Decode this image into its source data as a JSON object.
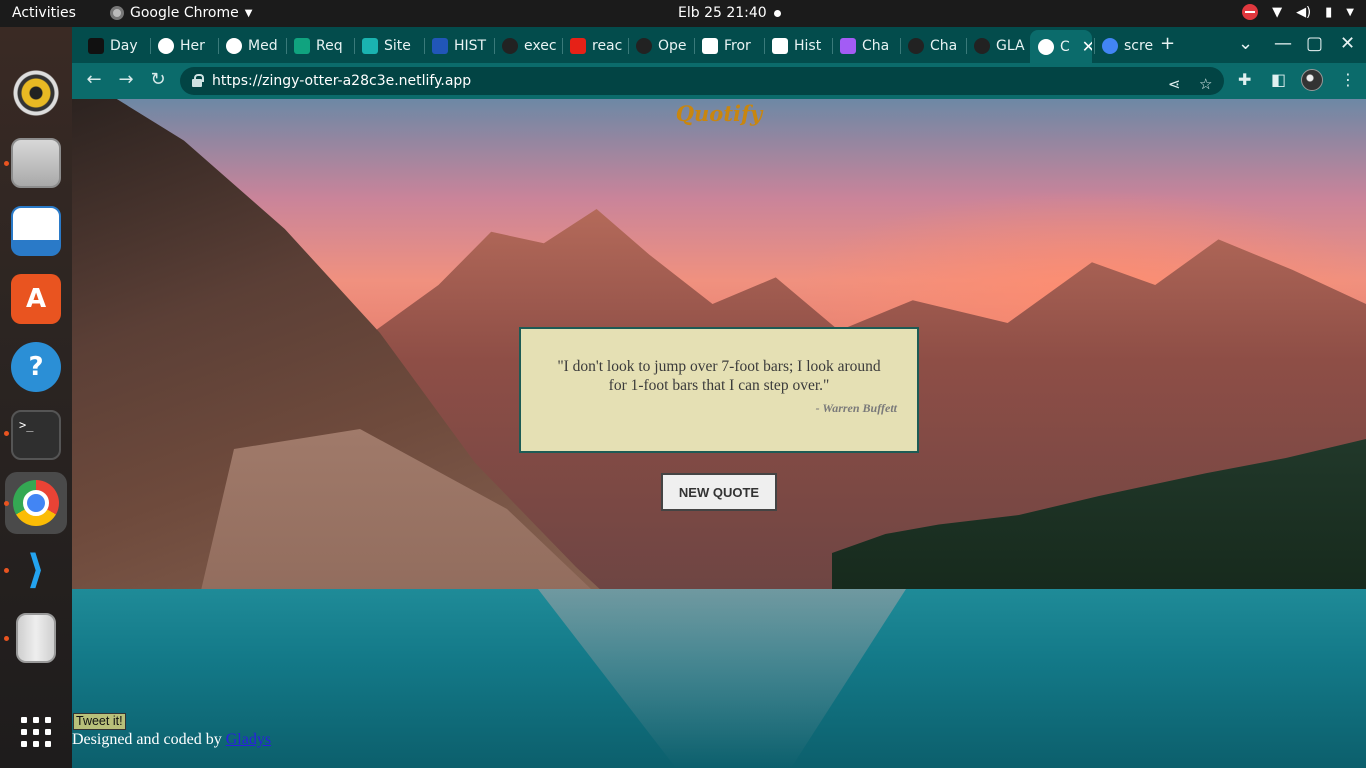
{
  "system": {
    "activities": "Activities",
    "app_name": "Google Chrome",
    "clock": "Elb 25  21:40"
  },
  "browser": {
    "tabs": [
      {
        "label": "Day",
        "icon": "newsletter-icon",
        "color": "#111111"
      },
      {
        "label": "Her",
        "icon": "globe-icon",
        "color": "#ffffff"
      },
      {
        "label": "Med",
        "icon": "globe-icon",
        "color": "#ffffff"
      },
      {
        "label": "Req",
        "icon": "chatgpt-icon",
        "color": "#10a37f"
      },
      {
        "label": "Site",
        "icon": "diamond-icon",
        "color": "#1ab3b0"
      },
      {
        "label": "HIST",
        "icon": "bookmark-icon",
        "color": "#2156b8"
      },
      {
        "label": "exec",
        "icon": "github-icon",
        "color": "#222222"
      },
      {
        "label": "reac",
        "icon": "youtube-icon",
        "color": "#e62117"
      },
      {
        "label": "Ope",
        "icon": "github-icon",
        "color": "#222222"
      },
      {
        "label": "Fror",
        "icon": "document-icon",
        "color": "#ffffff"
      },
      {
        "label": "Hist",
        "icon": "history-icon",
        "color": "#ffffff"
      },
      {
        "label": "Cha",
        "icon": "chat-icon",
        "color": "#a35cf5"
      },
      {
        "label": "Cha",
        "icon": "github-icon",
        "color": "#222222"
      },
      {
        "label": "GLA",
        "icon": "github-icon",
        "color": "#222222"
      },
      {
        "label": "C",
        "icon": "globe-icon",
        "color": "#ffffff"
      },
      {
        "label": "scre",
        "icon": "google-icon",
        "color": "#4285f4"
      }
    ],
    "url": "https://zingy-otter-a28c3e.netlify.app",
    "theme_color": "#0b6b6b"
  },
  "page": {
    "title": "Quotify",
    "quote": "\"I don't look to jump over 7-foot bars; I look around for 1-foot bars that I can step over.\"",
    "author": "- Warren Buffett",
    "new_quote_label": "NEW QUOTE",
    "tweet_label": "Tweet it!",
    "footer_text": "Designed and coded by ",
    "footer_link": "Gladys",
    "title_color": "#c8860f",
    "quote_box_color": "#e5e0b4"
  }
}
